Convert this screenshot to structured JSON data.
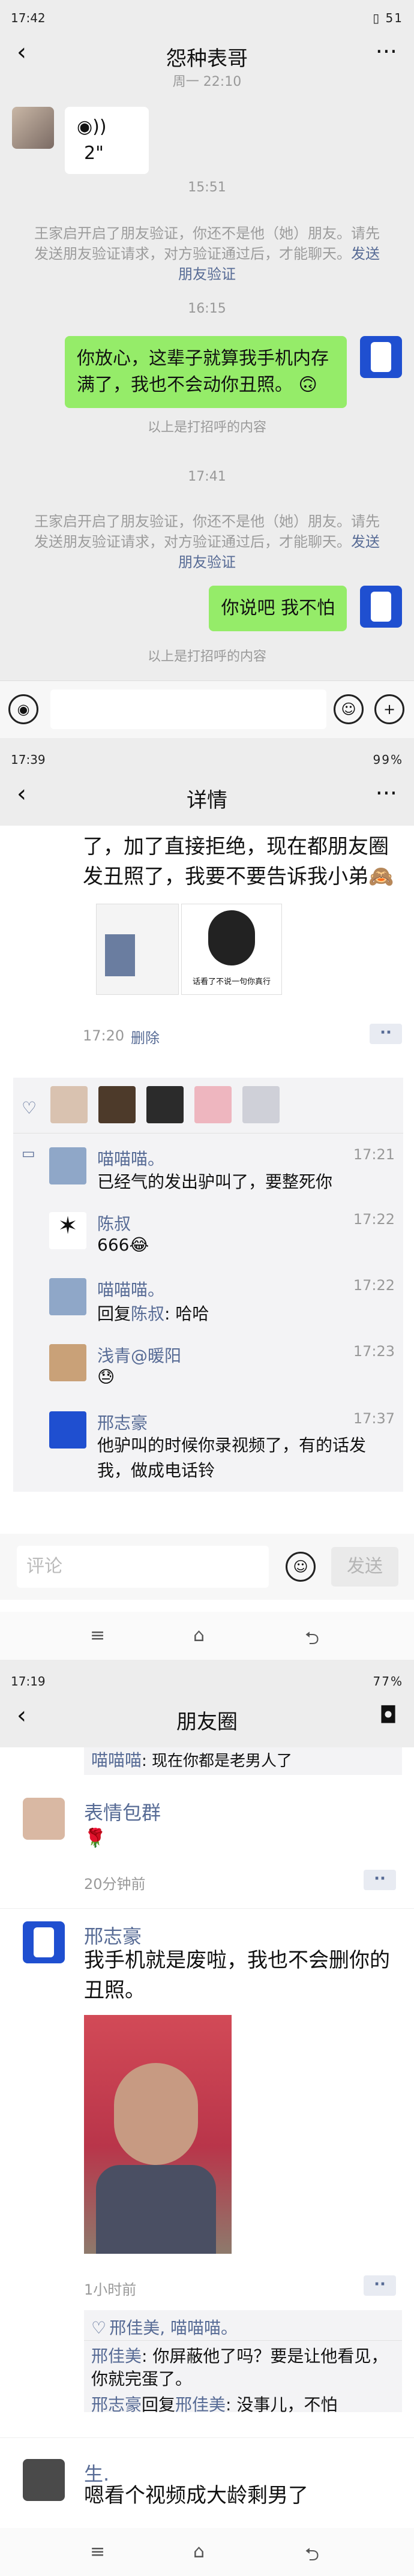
{
  "screen1": {
    "status_time": "17:42",
    "status_right": "▯ 51",
    "title": "怨种表哥",
    "date": "周一 22:10",
    "voice_duration": "2\"",
    "time1": "15:51",
    "sys1_text": "王家启开启了朋友验证，你还不是他（她）朋友。请先发送朋友验证请求，对方验证通过后，才能聊天。",
    "sys1_link": "发送朋友验证",
    "time2": "16:15",
    "my_msg1": "你放心，这辈子就算我手机内存满了，我也不会动你丑照。",
    "blocked1": "以上是打招呼的内容",
    "time3": "17:41",
    "sys2_text": "王家启开启了朋友验证，你还不是他（她）朋友。请先发送朋友验证请求，对方验证通过后，才能聊天。",
    "sys2_link": "发送朋友验证",
    "my_msg2": "你说吧 我不怕",
    "blocked2": "以上是打招呼的内容"
  },
  "screen2": {
    "status_time": "17:39",
    "status_right": "99%",
    "title": "详情",
    "post_text": "了，加了直接拒绝，现在都朋友圈发丑照了，我要不要告诉我小弟",
    "post_emoji": "🙈",
    "meme_caption": "话看了不说一句你真行",
    "post_time": "17:20",
    "delete_label": "删除",
    "comments": [
      {
        "name": "喵喵喵。",
        "time": "17:21",
        "reply_to": "",
        "text": "已经气的发出驴叫了，要整死你"
      },
      {
        "name": "陈叔",
        "time": "17:22",
        "reply_to": "",
        "text": "666😂"
      },
      {
        "name": "喵喵喵。",
        "time": "17:22",
        "reply_to": "陈叔",
        "text": "哈哈"
      },
      {
        "name": "浅青@暖阳",
        "time": "17:23",
        "reply_to": "",
        "text": "😓"
      },
      {
        "name": "邢志豪",
        "time": "17:37",
        "reply_to": "",
        "text": "他驴叫的时候你录视频了，有的话发我，做成电话铃"
      }
    ],
    "reply_word": "回复",
    "comment_placeholder": "评论",
    "send_label": "发送"
  },
  "screen3": {
    "status_time": "17:19",
    "status_right": "77%",
    "title": "朋友圈",
    "top_comment_name": "喵喵喵",
    "top_comment_text": "现在你都是老男人了",
    "post1_name": "表情包群",
    "post1_emoji": "🌹",
    "post1_time": "20分钟前",
    "post2_name": "邢志豪",
    "post2_text": "我手机就是废啦，我也不会删你的丑照。",
    "post2_time": "1小时前",
    "likes": "邢佳美, 喵喵喵。",
    "c1_name": "邢佳美",
    "c1_text": "你屏蔽他了吗？要是让他看见，你就完蛋了。",
    "c2_name": "邢志豪",
    "c2_reply_to": "邢佳美",
    "c2_text": "没事儿，不怕",
    "reply_word": "回复",
    "post3_name": "生.",
    "post3_text": "嗯看个视频成大龄剩男了"
  }
}
